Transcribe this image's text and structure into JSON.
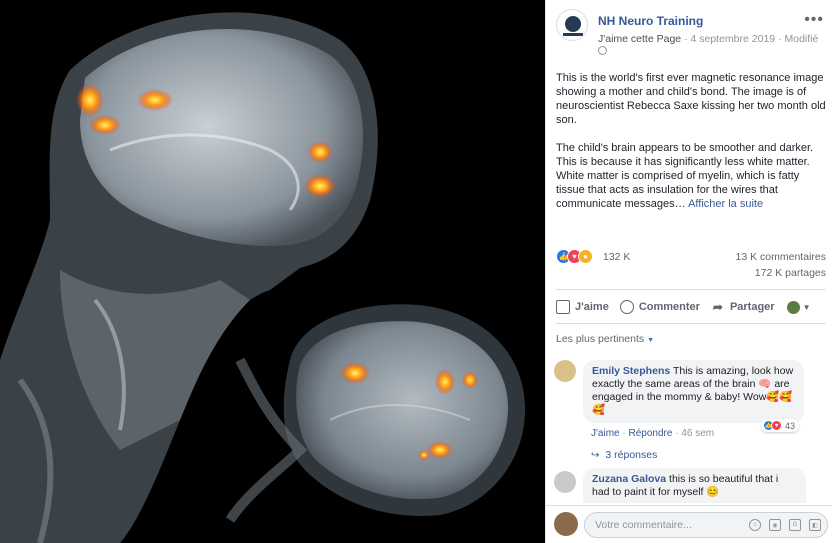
{
  "post": {
    "page_name": "NH Neuro Training",
    "like_page": "J'aime cette Page",
    "date": "4 septembre 2019",
    "modified": "Modifié",
    "separator": "·",
    "paragraph1": "This is the world's first ever magnetic resonance image showing a mother and child's bond. The image is of neuroscientist Rebecca Saxe kissing her two month old son.",
    "paragraph2": "The child's brain appears to be smoother and darker. This is because it has significantly less white matter. White matter is comprised of myelin, which is fatty tissue that acts as insulation for the wires that communicate messages…",
    "see_more": "Afficher la suite"
  },
  "stats": {
    "reactions": "132 K",
    "comments": "13 K commentaires",
    "shares": "172 K partages"
  },
  "actions": {
    "like": "J'aime",
    "comment": "Commenter",
    "share": "Partager"
  },
  "filter": {
    "label": "Les plus pertinents"
  },
  "comments": [
    {
      "author": "Emily Stephens",
      "text": "This is amazing, look how exactly the same areas of the brain 🧠 are engaged in the mommy & baby! Wow🥰🥰🥰",
      "like": "J'aime",
      "reply": "Répondre",
      "age": "46 sem",
      "reactions": "43",
      "replies": "3 réponses"
    },
    {
      "author": "Zuzana Galova",
      "text": "this is so beautiful that i had to paint it for myself 😊"
    }
  ],
  "composer": {
    "placeholder": "Votre commentaire..."
  },
  "colors": {
    "link": "#385898",
    "like_blue": "#2078f4",
    "love_red": "#f33e58",
    "wow_yellow": "#f7b125"
  }
}
